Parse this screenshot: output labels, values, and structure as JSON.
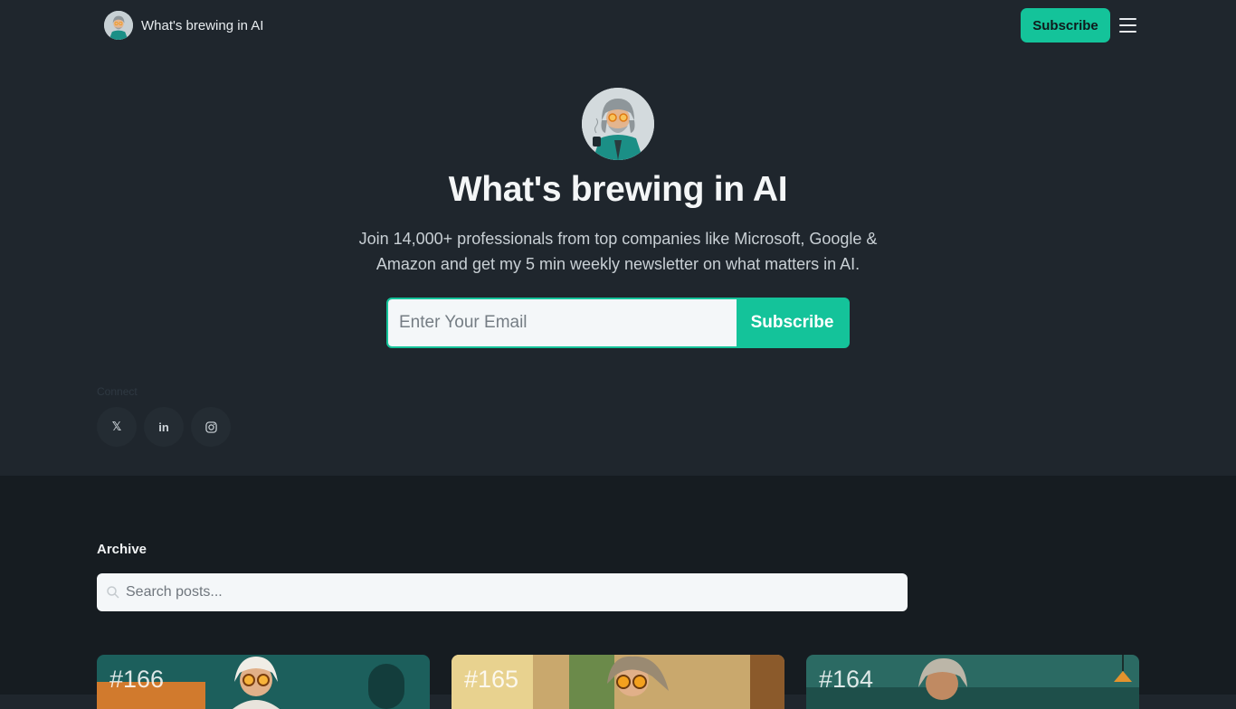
{
  "header": {
    "brand_name": "What's brewing in AI",
    "subscribe_label": "Subscribe"
  },
  "hero": {
    "title": "What's brewing in AI",
    "description": "Join 14,000+ professionals from top companies like Microsoft, Google & Amazon and get my 5 min weekly newsletter on what matters in AI.",
    "email_placeholder": "Enter Your Email",
    "subscribe_label": "Subscribe"
  },
  "connect": {
    "label": "Connect",
    "socials": [
      {
        "icon": "x-icon",
        "glyph": "𝕏"
      },
      {
        "icon": "linkedin-icon",
        "glyph": "in"
      },
      {
        "icon": "instagram-icon",
        "glyph": ""
      }
    ]
  },
  "archive": {
    "title": "Archive",
    "search_placeholder": "Search posts...",
    "posts": [
      {
        "number": "#166"
      },
      {
        "number": "#165"
      },
      {
        "number": "#164"
      }
    ]
  },
  "colors": {
    "accent": "#14c39a",
    "hero_bg": "#1f262d",
    "archive_bg": "#161c21"
  }
}
